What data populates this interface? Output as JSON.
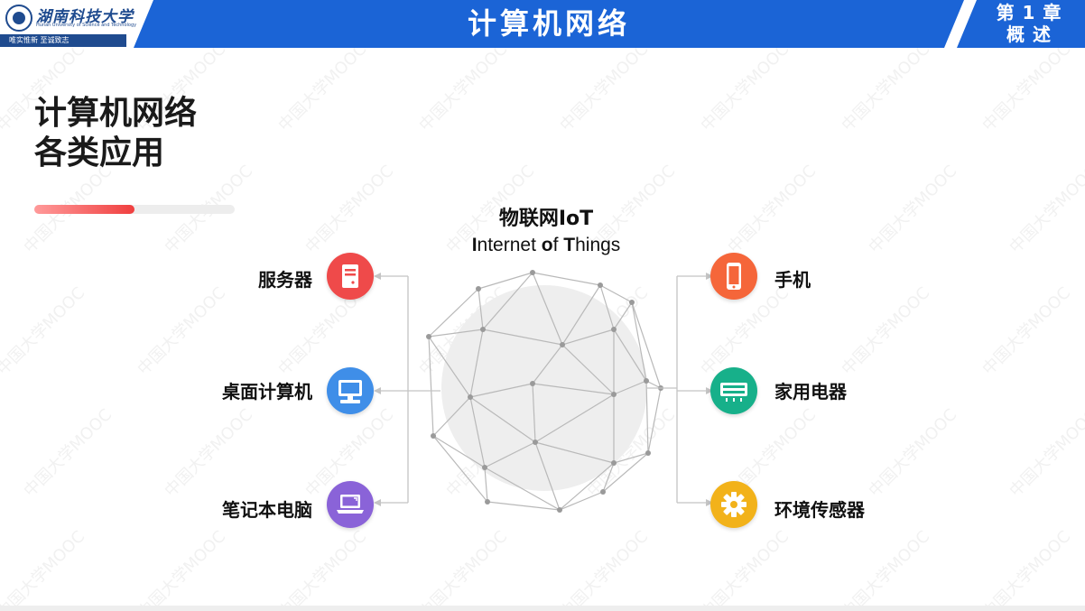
{
  "header": {
    "logo_cn": "湖南科技大学",
    "logo_en": "Hunan University of Science and Technology",
    "logo_motto": "唯实惟新  至诚致志",
    "title": "计算机网络",
    "chapter_line1": "第 1 章",
    "chapter_line2": "概 述"
  },
  "slide": {
    "title_line1": "计算机网络",
    "title_line2": "各类应用",
    "progress_fraction": 0.5
  },
  "iot": {
    "title": "物联网IoT",
    "subtitle_parts": [
      "I",
      "nternet ",
      "o",
      "f ",
      "T",
      "hings"
    ]
  },
  "left_items": [
    {
      "label": "服务器",
      "icon": "server-icon",
      "color": "#ef4a4a"
    },
    {
      "label": "桌面计算机",
      "icon": "desktop-icon",
      "color": "#3f8ee8"
    },
    {
      "label": "笔记本电脑",
      "icon": "laptop-icon",
      "color": "#8a63d8"
    }
  ],
  "right_items": [
    {
      "label": "手机",
      "icon": "mobile-phone-icon",
      "color": "#f5663a"
    },
    {
      "label": "家用电器",
      "icon": "air-conditioner-icon",
      "color": "#17b08a"
    },
    {
      "label": "环境传感器",
      "icon": "gear-icon",
      "color": "#f2b21a"
    }
  ],
  "watermark_text": "中国大学MOOC"
}
